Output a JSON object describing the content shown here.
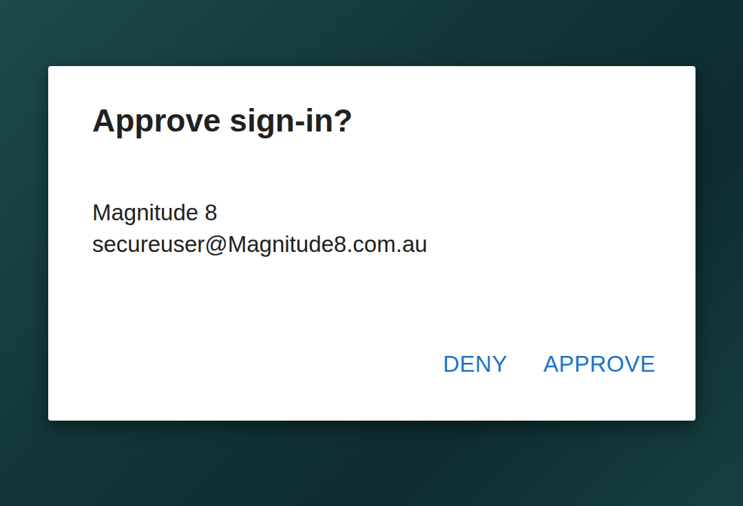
{
  "dialog": {
    "title": "Approve sign-in?",
    "account": {
      "name": "Magnitude 8",
      "email": "secureuser@Magnitude8.com.au"
    },
    "buttons": [
      {
        "label": "DENY"
      },
      {
        "label": "APPROVE"
      }
    ]
  }
}
